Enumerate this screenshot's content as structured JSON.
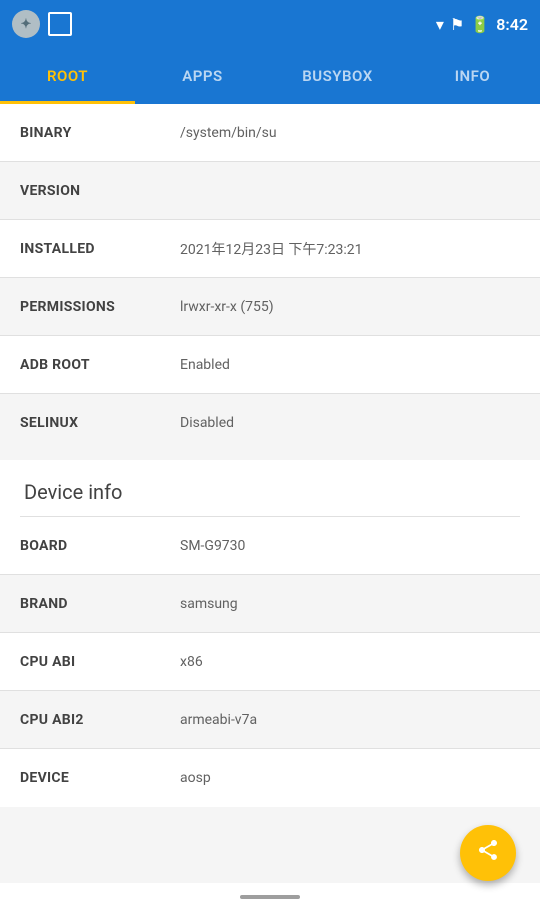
{
  "statusBar": {
    "time": "8:42"
  },
  "tabs": [
    {
      "id": "root",
      "label": "ROOT",
      "active": true
    },
    {
      "id": "apps",
      "label": "APPS",
      "active": false
    },
    {
      "id": "busybox",
      "label": "BUSYBOX",
      "active": false
    },
    {
      "id": "info",
      "label": "INFO",
      "active": false
    }
  ],
  "rootInfo": {
    "rows": [
      {
        "label": "BINARY",
        "value": "/system/bin/su",
        "alt": false
      },
      {
        "label": "VERSION",
        "value": "",
        "alt": true
      },
      {
        "label": "INSTALLED",
        "value": "2021年12月23日 下午7:23:21",
        "alt": false
      },
      {
        "label": "PERMISSIONS",
        "value": "lrwxr-xr-x (755)",
        "alt": true
      },
      {
        "label": "ADB ROOT",
        "value": "Enabled",
        "alt": false
      },
      {
        "label": "SELINUX",
        "value": "Disabled",
        "alt": true
      }
    ]
  },
  "deviceInfo": {
    "title": "Device info",
    "rows": [
      {
        "label": "BOARD",
        "value": "SM-G9730",
        "alt": false
      },
      {
        "label": "BRAND",
        "value": "samsung",
        "alt": true
      },
      {
        "label": "CPU ABI",
        "value": "x86",
        "alt": false
      },
      {
        "label": "CPU ABI2",
        "value": "armeabi-v7a",
        "alt": true
      },
      {
        "label": "DEVICE",
        "value": "aosp",
        "alt": false
      }
    ]
  },
  "fab": {
    "icon": "share"
  }
}
